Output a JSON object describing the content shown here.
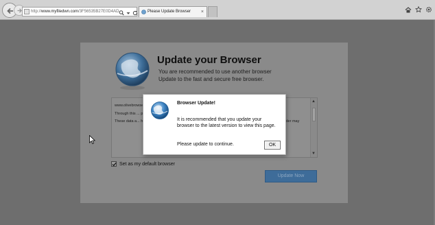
{
  "browser": {
    "address": {
      "domain": "www.myfiledwn.com",
      "prefix": "http://",
      "path": "/3F56535B27E0D4AD"
    },
    "tab": {
      "title": "Please Update Browser",
      "close_glyph": "×"
    }
  },
  "page": {
    "title": "Update your Browser",
    "subtitle_1": "You are recommended to use another browser",
    "subtitle_2": "Update to the fast and secure free browser.",
    "terms": [
      "www.olivebrowser.com ... of the data that is af... policy with regards to dat... a collection and ...",
      "Through this ... providing our services, ... est for users, related ...",
      "These data a... holder, properly registered at the Agency of Data Protection. Nevertheless, the data holder may"
    ],
    "default_checkbox_label": "Set as my default browser",
    "default_checked": true,
    "update_button_label": "Update Now"
  },
  "dialog": {
    "title": "Browser Update!",
    "message": "It is recommended that you update your browser to the latest version to view this page.",
    "prompt": "Please update to continue.",
    "ok_label": "OK"
  },
  "colors": {
    "overlay": "#6e6e6e",
    "update_button": "#3e6c99",
    "dialog_bg": "#ffffff"
  },
  "icons": [
    "back-arrow-icon",
    "forward-arrow-icon",
    "search-icon",
    "refresh-icon",
    "home-icon",
    "star-icon",
    "gear-icon",
    "globe-icon",
    "checkmark-icon"
  ]
}
